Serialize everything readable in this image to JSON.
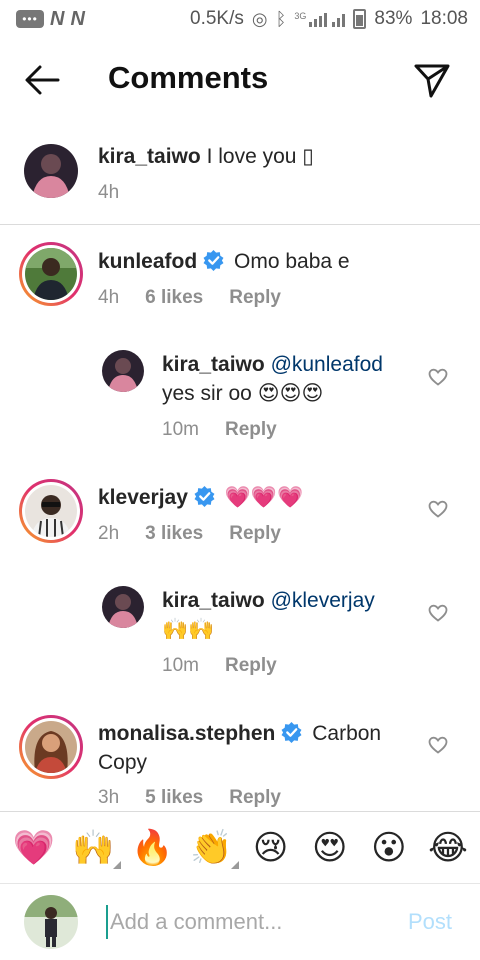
{
  "status_bar": {
    "speed": "0.5K/s",
    "network": "3G",
    "battery": "83%",
    "time": "18:08"
  },
  "header": {
    "title": "Comments"
  },
  "caption": {
    "username": "kira_taiwo",
    "text": "I love you ▯",
    "time": "4h"
  },
  "comments": [
    {
      "username": "kunleafod",
      "verified": true,
      "text": "Omo baba e",
      "time": "4h",
      "likes": "6 likes",
      "reply": "Reply"
    },
    {
      "username": "kira_taiwo",
      "mention": "@kunleafod",
      "text": "yes sir oo 😍😍😍",
      "time": "10m",
      "reply": "Reply"
    },
    {
      "username": "kleverjay",
      "verified": true,
      "text": "💗💗💗",
      "time": "2h",
      "likes": "3 likes",
      "reply": "Reply"
    },
    {
      "username": "kira_taiwo",
      "mention": "@kleverjay",
      "text": "🙌🙌",
      "time": "10m",
      "reply": "Reply"
    },
    {
      "username": "monalisa.stephen",
      "verified": true,
      "text": "Carbon",
      "text2": "Copy",
      "time": "3h",
      "likes": "5 likes",
      "reply": "Reply"
    }
  ],
  "emoji_bar": [
    "💗",
    "🙌",
    "🔥",
    "👏",
    "😢",
    "😍",
    "😮",
    "😂"
  ],
  "input": {
    "placeholder": "Add a comment...",
    "post_label": "Post"
  },
  "colors": {
    "verified": "#3897f0",
    "post_disabled": "#b2dffc",
    "mention": "#00376b",
    "muted": "#8e8e8e"
  }
}
